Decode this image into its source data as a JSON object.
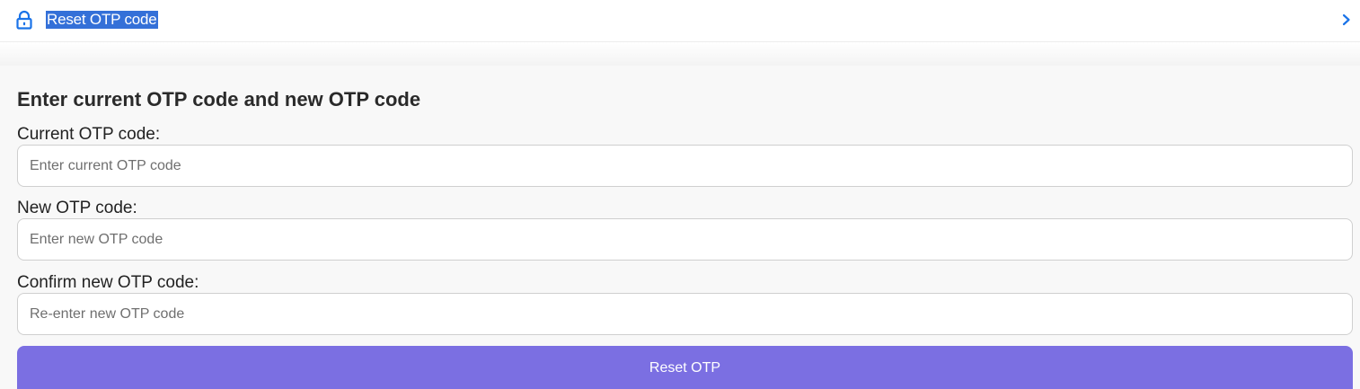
{
  "header": {
    "title": "Reset OTP code",
    "icon": "lock-icon",
    "expand_icon": "chevron-right-icon",
    "accent_color": "#1a73e8",
    "selection_color": "#3470d8"
  },
  "form": {
    "heading": "Enter current OTP code and new OTP code",
    "current": {
      "label": "Current OTP code:",
      "placeholder": "Enter current OTP code",
      "value": ""
    },
    "new": {
      "label": "New OTP code:",
      "placeholder": "Enter new OTP code",
      "value": ""
    },
    "confirm": {
      "label": "Confirm new OTP code:",
      "placeholder": "Re-enter new OTP code",
      "value": ""
    },
    "submit_label": "Reset OTP",
    "submit_color": "#7b6fe2"
  }
}
